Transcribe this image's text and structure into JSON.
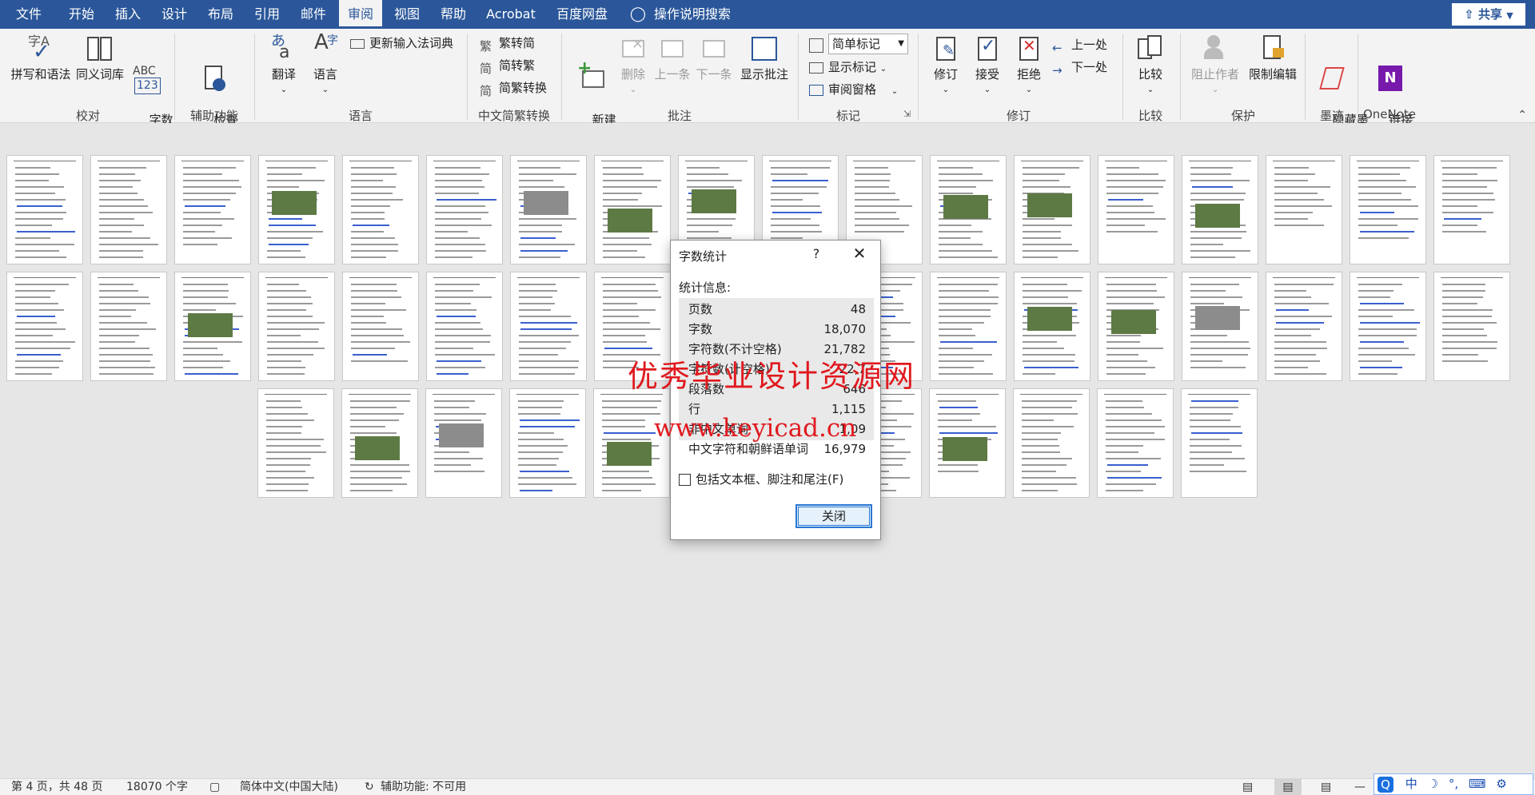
{
  "tabs": [
    "文件",
    "开始",
    "插入",
    "设计",
    "布局",
    "引用",
    "邮件",
    "审阅",
    "视图",
    "帮助",
    "Acrobat",
    "百度网盘"
  ],
  "active_tab": "审阅",
  "tell_me": "操作说明搜索",
  "share_label": "共享",
  "ribbon": {
    "proofing": {
      "label": "校对",
      "spell": "拼写和语法",
      "thesaurus": "同义词库",
      "wordcount": "字数\n统计"
    },
    "accessibility": {
      "label": "辅助功能",
      "check": "检查\n辅助功能"
    },
    "language": {
      "label": "语言",
      "translate": "翻译",
      "language": "语言",
      "update_ime": "更新输入法词典"
    },
    "chinese": {
      "label": "中文简繁转换",
      "to_simplified": "繁转简",
      "to_traditional": "简转繁",
      "convert": "简繁转换"
    },
    "comments": {
      "label": "批注",
      "new": "新建\n批注",
      "delete": "删除",
      "prev": "上一条",
      "next": "下一条",
      "show": "显示批注"
    },
    "tracking": {
      "label": "标记",
      "markup_value": "简单标记",
      "show_markup": "显示标记",
      "pane": "审阅窗格"
    },
    "changes": {
      "label": "修订",
      "track": "修订",
      "accept": "接受",
      "reject": "拒绝",
      "prev": "上一处",
      "next": "下一处"
    },
    "compare": {
      "label": "比较",
      "compare": "比较"
    },
    "protect": {
      "label": "保护",
      "block": "阻止作者",
      "restrict": "限制编辑"
    },
    "ink": {
      "label": "墨迹",
      "hide": "隐藏墨\n迹"
    },
    "onenote": {
      "label": "OneNote",
      "link": "链接\n笔记"
    }
  },
  "dialog": {
    "title": "字数统计",
    "help": "?",
    "stats_label": "统计信息:",
    "rows": [
      {
        "label": "页数",
        "value": "48"
      },
      {
        "label": "字数",
        "value": "18,070"
      },
      {
        "label": "字符数(不计空格)",
        "value": "21,782"
      },
      {
        "label": "字符数(计空格)",
        "value": "22,7"
      },
      {
        "label": "段落数",
        "value": "646"
      },
      {
        "label": "行",
        "value": "1,115"
      },
      {
        "label": "非中文单词",
        "value": "1,09"
      },
      {
        "label": "中文字符和朝鲜语单词",
        "value": "16,979"
      }
    ],
    "checkbox_label": "包括文本框、脚注和尾注(F)",
    "close_button": "关闭"
  },
  "watermark": {
    "line1": "优秀毕业设计资源网",
    "line2": "www.keyicad.cn"
  },
  "status": {
    "page": "第 4 页，共 48 页",
    "words": "18070 个字",
    "language": "简体中文(中国大陆)",
    "accessibility": "辅助功能: 不可用"
  },
  "ime": {
    "items": [
      "中",
      "☽",
      "°,",
      "⌨",
      "⚙"
    ]
  }
}
